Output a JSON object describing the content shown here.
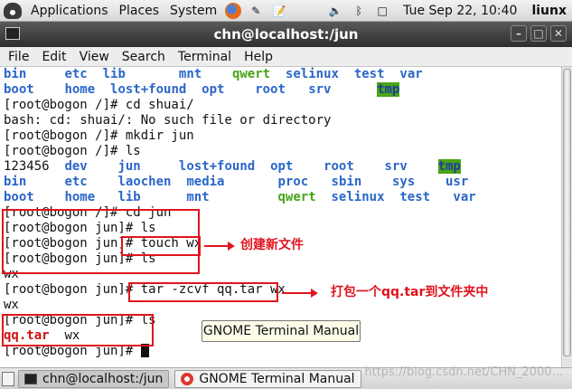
{
  "top_panel": {
    "menus": [
      "Applications",
      "Places",
      "System"
    ],
    "clock": "Tue Sep 22, 10:40",
    "user": "liunx",
    "icons": [
      "gnome-foot-icon",
      "firefox-icon",
      "file-edit-icon",
      "notes-icon",
      "volume-icon",
      "bluetooth-icon",
      "network-icon"
    ]
  },
  "window": {
    "title": "chn@localhost:/jun",
    "menu": [
      "File",
      "Edit",
      "View",
      "Search",
      "Terminal",
      "Help"
    ]
  },
  "terminal": {
    "lines": [
      [
        [
          "bin",
          "dir"
        ],
        [
          "     ",
          ""
        ],
        [
          "etc",
          "dir"
        ],
        [
          "  ",
          ""
        ],
        [
          "lib",
          "dir"
        ],
        [
          "       ",
          ""
        ],
        [
          "mnt",
          "dir"
        ],
        [
          "    ",
          ""
        ],
        [
          "qwert",
          "exe"
        ],
        [
          "  ",
          ""
        ],
        [
          "selinux",
          "dir"
        ],
        [
          "  ",
          ""
        ],
        [
          "test",
          "dir"
        ],
        [
          "  ",
          ""
        ],
        [
          "var",
          "dir"
        ]
      ],
      [
        [
          "boot",
          "dir"
        ],
        [
          "    ",
          ""
        ],
        [
          "home",
          "dir"
        ],
        [
          "  ",
          ""
        ],
        [
          "lost+found",
          "dir"
        ],
        [
          "  ",
          ""
        ],
        [
          "opt",
          "dir"
        ],
        [
          "    ",
          ""
        ],
        [
          "root",
          "dir"
        ],
        [
          "   ",
          ""
        ],
        [
          "srv",
          "dir"
        ],
        [
          "      ",
          ""
        ],
        [
          "tmp",
          "tmp"
        ]
      ],
      [
        [
          "[root@bogon /]# cd shuai/",
          ""
        ]
      ],
      [
        [
          "bash: cd: shuai/: No such file or directory",
          ""
        ]
      ],
      [
        [
          "[root@bogon /]# mkdir jun",
          ""
        ]
      ],
      [
        [
          "[root@bogon /]# ls",
          ""
        ]
      ],
      [
        [
          "123456",
          ""
        ],
        [
          "  ",
          ""
        ],
        [
          "dev",
          "dir"
        ],
        [
          "    ",
          ""
        ],
        [
          "jun",
          "dir"
        ],
        [
          "     ",
          ""
        ],
        [
          "lost+found",
          "dir"
        ],
        [
          "  ",
          ""
        ],
        [
          "opt",
          "dir"
        ],
        [
          "    ",
          ""
        ],
        [
          "root",
          "dir"
        ],
        [
          "    ",
          ""
        ],
        [
          "srv",
          "dir"
        ],
        [
          "    ",
          ""
        ],
        [
          "tmp",
          "tmp"
        ]
      ],
      [
        [
          "bin",
          "dir"
        ],
        [
          "     ",
          ""
        ],
        [
          "etc",
          "dir"
        ],
        [
          "    ",
          ""
        ],
        [
          "laochen",
          "dir"
        ],
        [
          "  ",
          ""
        ],
        [
          "media",
          "dir"
        ],
        [
          "       ",
          ""
        ],
        [
          "proc",
          "dir"
        ],
        [
          "   ",
          ""
        ],
        [
          "sbin",
          "dir"
        ],
        [
          "    ",
          ""
        ],
        [
          "sys",
          "dir"
        ],
        [
          "    ",
          ""
        ],
        [
          "usr",
          "dir"
        ]
      ],
      [
        [
          "boot",
          "dir"
        ],
        [
          "    ",
          ""
        ],
        [
          "home",
          "dir"
        ],
        [
          "   ",
          ""
        ],
        [
          "lib",
          "dir"
        ],
        [
          "      ",
          ""
        ],
        [
          "mnt",
          "dir"
        ],
        [
          "         ",
          ""
        ],
        [
          "qwert",
          "exe"
        ],
        [
          "  ",
          ""
        ],
        [
          "selinux",
          "dir"
        ],
        [
          "  ",
          ""
        ],
        [
          "test",
          "dir"
        ],
        [
          "   ",
          ""
        ],
        [
          "var",
          "dir"
        ]
      ],
      [
        [
          "[root@bogon /]# cd jun",
          ""
        ]
      ],
      [
        [
          "[root@bogon jun]# ls",
          ""
        ]
      ],
      [
        [
          "[root@bogon jun]# touch wx",
          ""
        ]
      ],
      [
        [
          "[root@bogon jun]# ls",
          ""
        ]
      ],
      [
        [
          "wx",
          ""
        ]
      ],
      [
        [
          "[root@bogon jun]# tar -zcvf qq.tar wx",
          ""
        ]
      ],
      [
        [
          "wx",
          ""
        ]
      ],
      [
        [
          "[root@bogon jun]# ls",
          ""
        ]
      ],
      [
        [
          "qq.tar",
          "arc"
        ],
        [
          "  ",
          ""
        ],
        [
          "wx",
          ""
        ]
      ],
      [
        [
          "[root@bogon jun]# ",
          ""
        ],
        [
          "",
          "cursor"
        ]
      ]
    ]
  },
  "annotations": {
    "note1": "创建新文件",
    "note2": "打包一个qq.tar到文件夹中"
  },
  "tooltip": "GNOME Terminal Manual",
  "taskbar": {
    "tasks": [
      "chn@localhost:/jun",
      "GNOME Terminal Manual"
    ]
  },
  "watermark": "https://blog.csdn.net/CHN_2000..."
}
